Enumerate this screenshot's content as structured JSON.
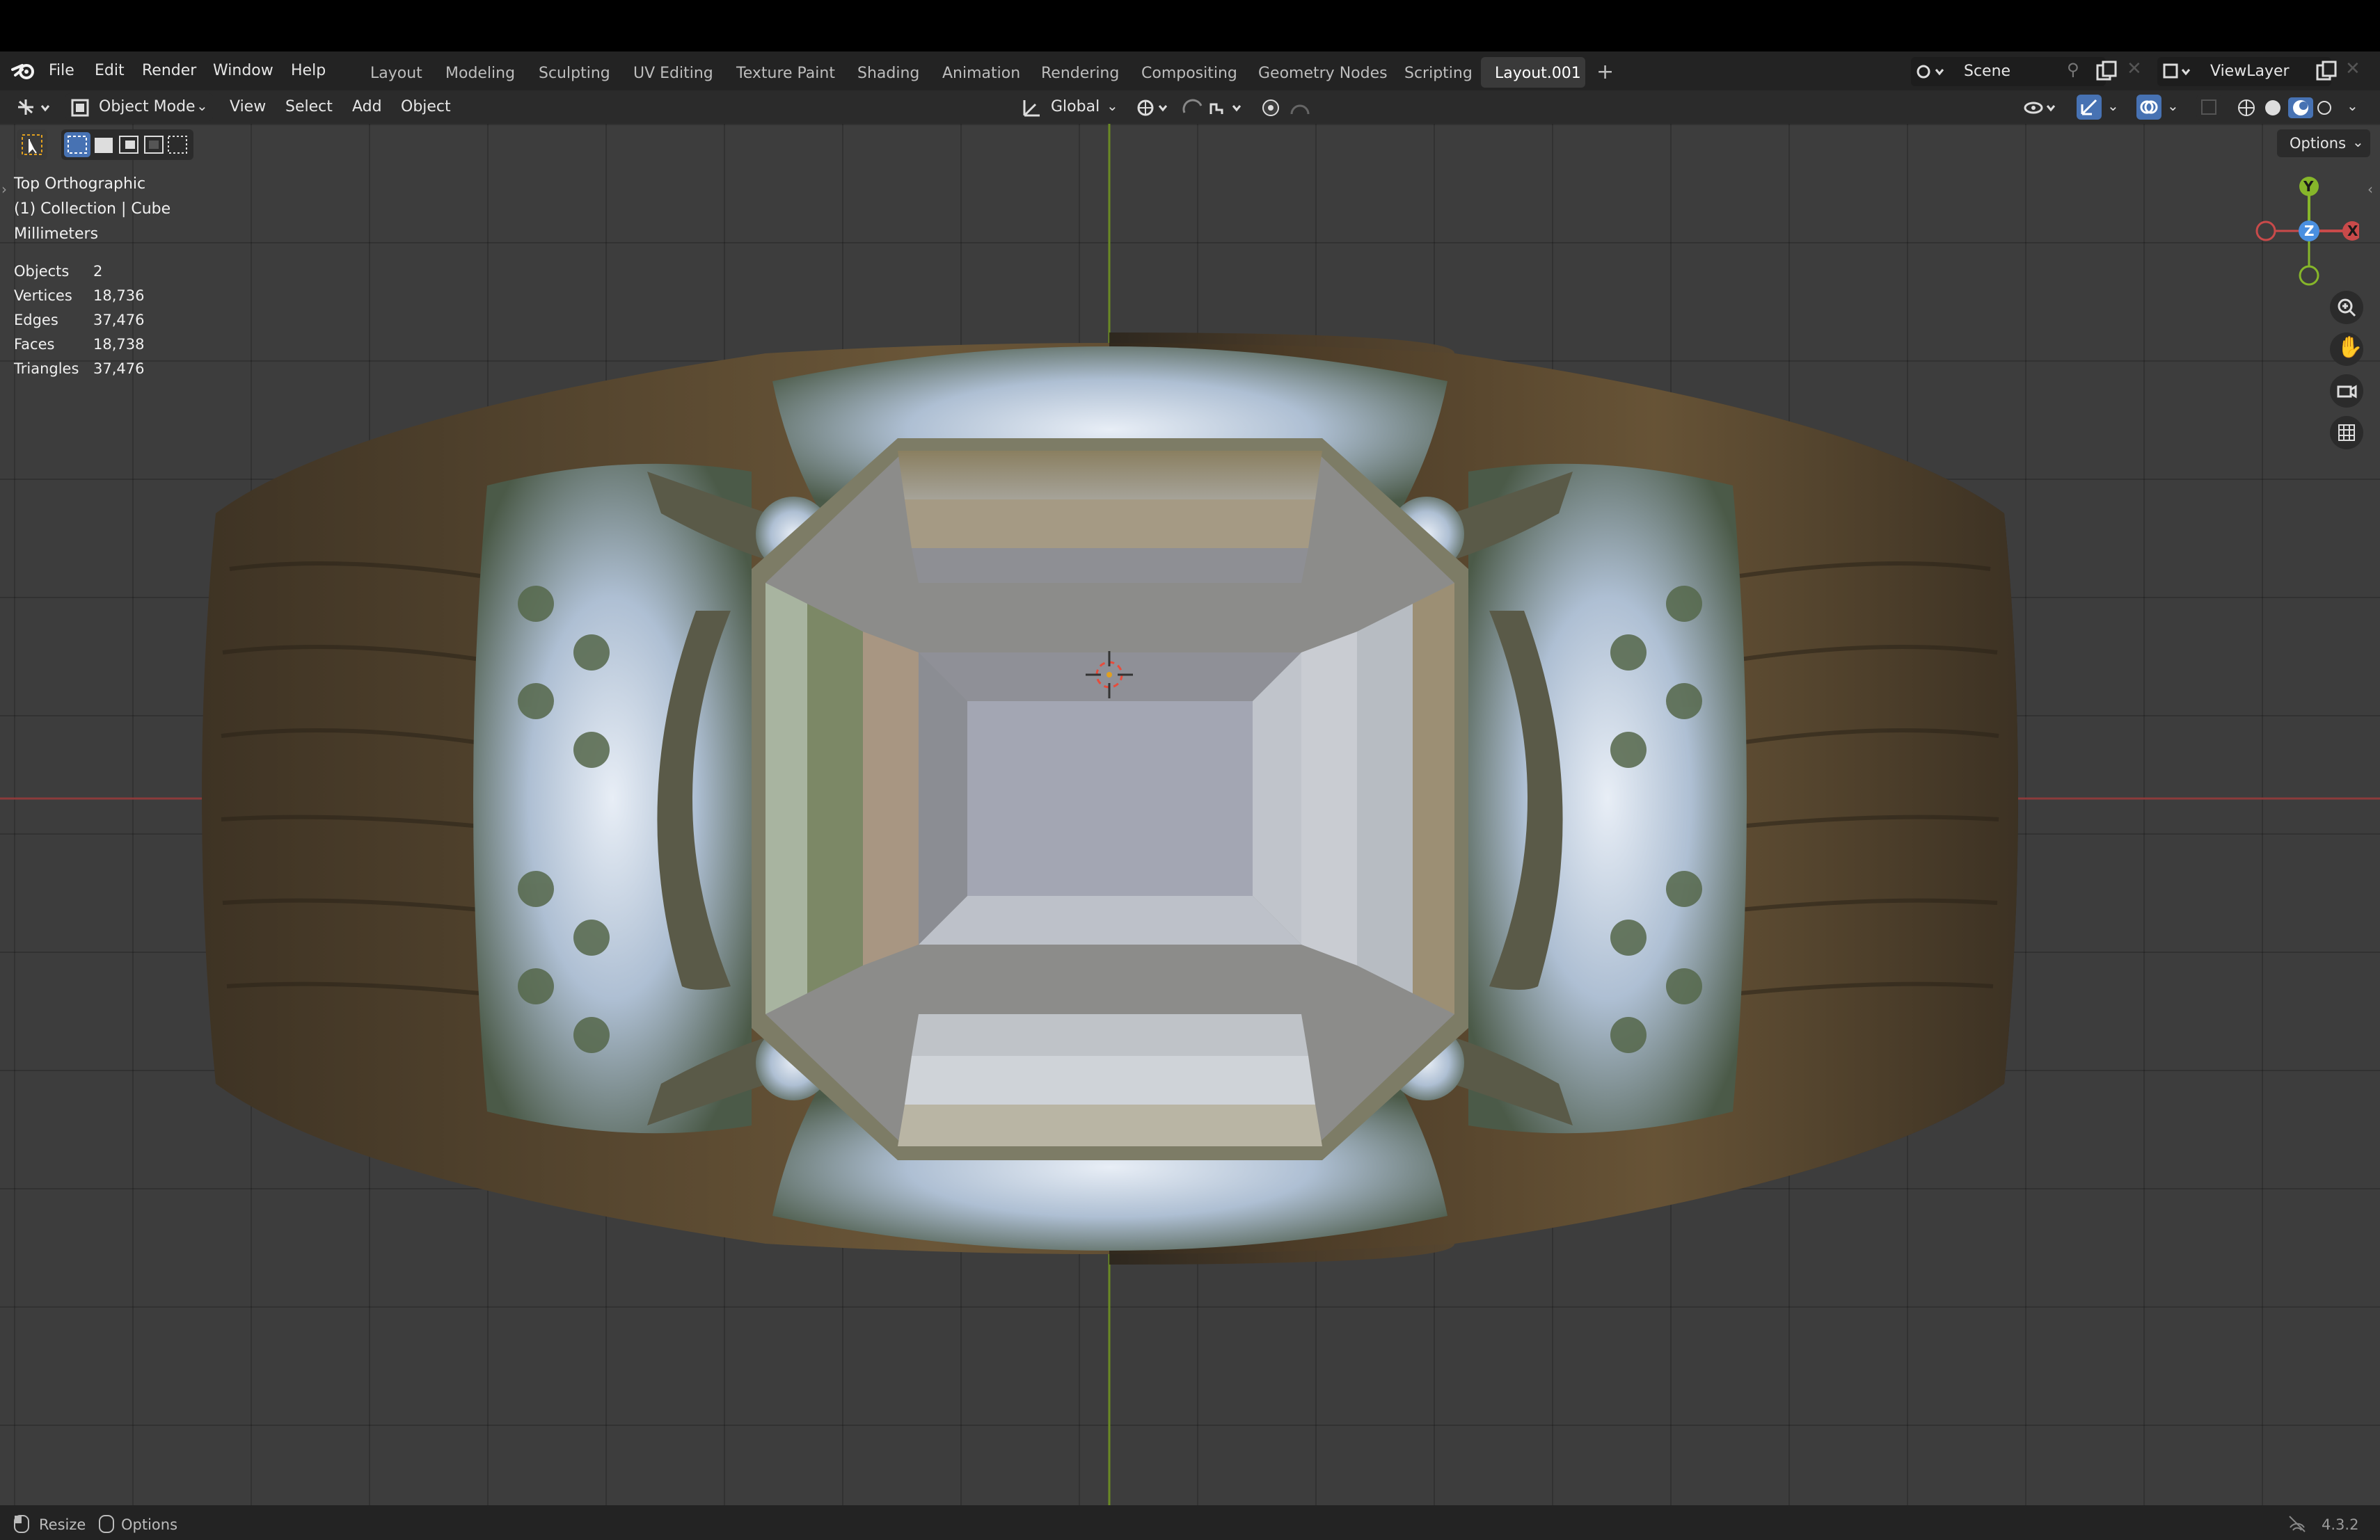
{
  "menubar": {
    "items": [
      "File",
      "Edit",
      "Render",
      "Window",
      "Help"
    ]
  },
  "workspaces": [
    "Layout",
    "Modeling",
    "Sculpting",
    "UV Editing",
    "Texture Paint",
    "Shading",
    "Animation",
    "Rendering",
    "Compositing",
    "Geometry Nodes",
    "Scripting",
    "Layout.001"
  ],
  "scene": {
    "name": "Scene"
  },
  "view_layer": {
    "name": "ViewLayer"
  },
  "header": {
    "mode": "Object Mode",
    "menus": [
      "View",
      "Select",
      "Add",
      "Object"
    ],
    "orientation": "Global",
    "options": "Options"
  },
  "viewport": {
    "view_name": "Top Orthographic",
    "collection": "(1) Collection | Cube",
    "units": "Millimeters",
    "stats": [
      {
        "label": "Objects",
        "value": "2"
      },
      {
        "label": "Vertices",
        "value": "18,736"
      },
      {
        "label": "Edges",
        "value": "37,476"
      },
      {
        "label": "Faces",
        "value": "18,738"
      },
      {
        "label": "Triangles",
        "value": "37,476"
      }
    ],
    "gizmo": {
      "y": "Y",
      "z": "Z",
      "x": "X"
    }
  },
  "statusbar": {
    "resize": "Resize",
    "options": "Options",
    "version": "4.3.2"
  },
  "colors": {
    "axis_x": "#c94a4a",
    "axis_y": "#86b62a",
    "axis_z": "#4a8fe0",
    "accent": "#4772b3"
  }
}
